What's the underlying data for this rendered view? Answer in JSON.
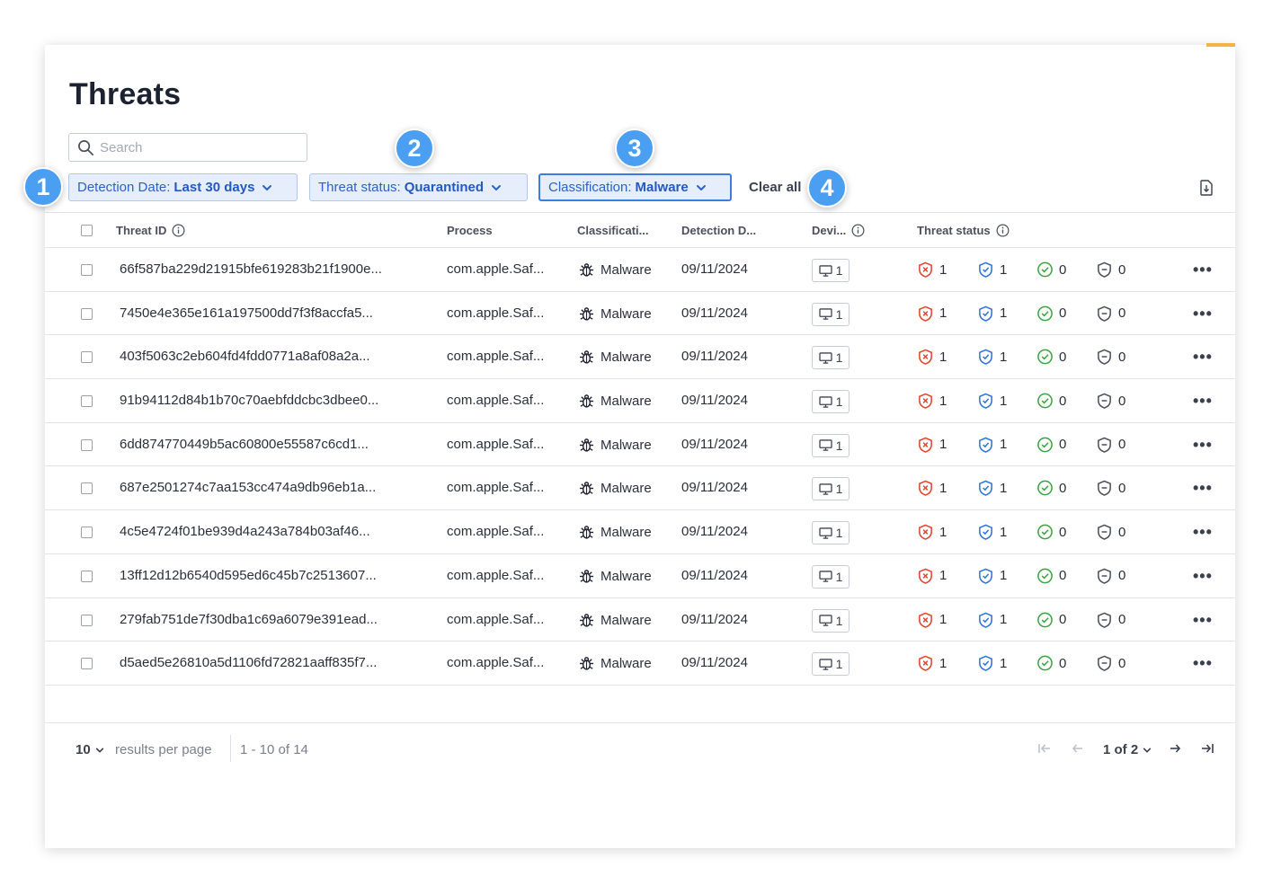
{
  "page": {
    "title": "Threats"
  },
  "search": {
    "placeholder": "Search"
  },
  "filters": {
    "detection_date": {
      "label": "Detection Date:",
      "value": "Last 30 days"
    },
    "threat_status": {
      "label": "Threat status:",
      "value": "Quarantined"
    },
    "classification": {
      "label": "Classification:",
      "value": "Malware"
    },
    "clear_all": "Clear all"
  },
  "callouts": [
    "1",
    "2",
    "3",
    "4"
  ],
  "table": {
    "headers": {
      "threat_id": "Threat ID",
      "process": "Process",
      "classification": "Classificati...",
      "detection_date": "Detection D...",
      "devices": "Devi...",
      "threat_status": "Threat status"
    },
    "rows": [
      {
        "id": "66f587ba229d21915bfe619283b21f1900e...",
        "process": "com.apple.Saf...",
        "classification": "Malware",
        "date": "09/11/2024",
        "devices": "1",
        "s_failed": "1",
        "s_quarantined": "1",
        "s_resolved": "0",
        "s_other": "0"
      },
      {
        "id": "7450e4e365e161a197500dd7f3f8accfa5...",
        "process": "com.apple.Saf...",
        "classification": "Malware",
        "date": "09/11/2024",
        "devices": "1",
        "s_failed": "1",
        "s_quarantined": "1",
        "s_resolved": "0",
        "s_other": "0"
      },
      {
        "id": "403f5063c2eb604fd4fdd0771a8af08a2a...",
        "process": "com.apple.Saf...",
        "classification": "Malware",
        "date": "09/11/2024",
        "devices": "1",
        "s_failed": "1",
        "s_quarantined": "1",
        "s_resolved": "0",
        "s_other": "0"
      },
      {
        "id": "91b94112d84b1b70c70aebfddcbc3dbee0...",
        "process": "com.apple.Saf...",
        "classification": "Malware",
        "date": "09/11/2024",
        "devices": "1",
        "s_failed": "1",
        "s_quarantined": "1",
        "s_resolved": "0",
        "s_other": "0"
      },
      {
        "id": "6dd874770449b5ac60800e55587c6cd1...",
        "process": "com.apple.Saf...",
        "classification": "Malware",
        "date": "09/11/2024",
        "devices": "1",
        "s_failed": "1",
        "s_quarantined": "1",
        "s_resolved": "0",
        "s_other": "0"
      },
      {
        "id": "687e2501274c7aa153cc474a9db96eb1a...",
        "process": "com.apple.Saf...",
        "classification": "Malware",
        "date": "09/11/2024",
        "devices": "1",
        "s_failed": "1",
        "s_quarantined": "1",
        "s_resolved": "0",
        "s_other": "0"
      },
      {
        "id": "4c5e4724f01be939d4a243a784b03af46...",
        "process": "com.apple.Saf...",
        "classification": "Malware",
        "date": "09/11/2024",
        "devices": "1",
        "s_failed": "1",
        "s_quarantined": "1",
        "s_resolved": "0",
        "s_other": "0"
      },
      {
        "id": "13ff12d12b6540d595ed6c45b7c2513607...",
        "process": "com.apple.Saf...",
        "classification": "Malware",
        "date": "09/11/2024",
        "devices": "1",
        "s_failed": "1",
        "s_quarantined": "1",
        "s_resolved": "0",
        "s_other": "0"
      },
      {
        "id": "279fab751de7f30dba1c69a6079e391ead...",
        "process": "com.apple.Saf...",
        "classification": "Malware",
        "date": "09/11/2024",
        "devices": "1",
        "s_failed": "1",
        "s_quarantined": "1",
        "s_resolved": "0",
        "s_other": "0"
      },
      {
        "id": "d5aed5e26810a5d1106fd72821aaff835f7...",
        "process": "com.apple.Saf...",
        "classification": "Malware",
        "date": "09/11/2024",
        "devices": "1",
        "s_failed": "1",
        "s_quarantined": "1",
        "s_resolved": "0",
        "s_other": "0"
      }
    ]
  },
  "pagination": {
    "per_page": "10",
    "per_page_label": "results per page",
    "range": "1 - 10 of 14",
    "current_page": "1 of 2"
  },
  "colors": {
    "accent": "#2c62c6",
    "callout": "#4b9ff2",
    "status_failed": "#e0452f",
    "status_quarantined": "#2f74d8",
    "status_resolved": "#3aa340",
    "status_other": "#4a505c"
  },
  "icons": {
    "search": "search-icon",
    "chevron": "chevron-down-icon",
    "export": "export-icon",
    "info": "info-icon",
    "bug": "bug-icon",
    "device": "monitor-icon",
    "failed": "shield-x-icon",
    "quarantined": "shield-check-icon",
    "resolved": "check-circle-icon",
    "other": "shield-outline-icon",
    "more": "more-icon"
  }
}
